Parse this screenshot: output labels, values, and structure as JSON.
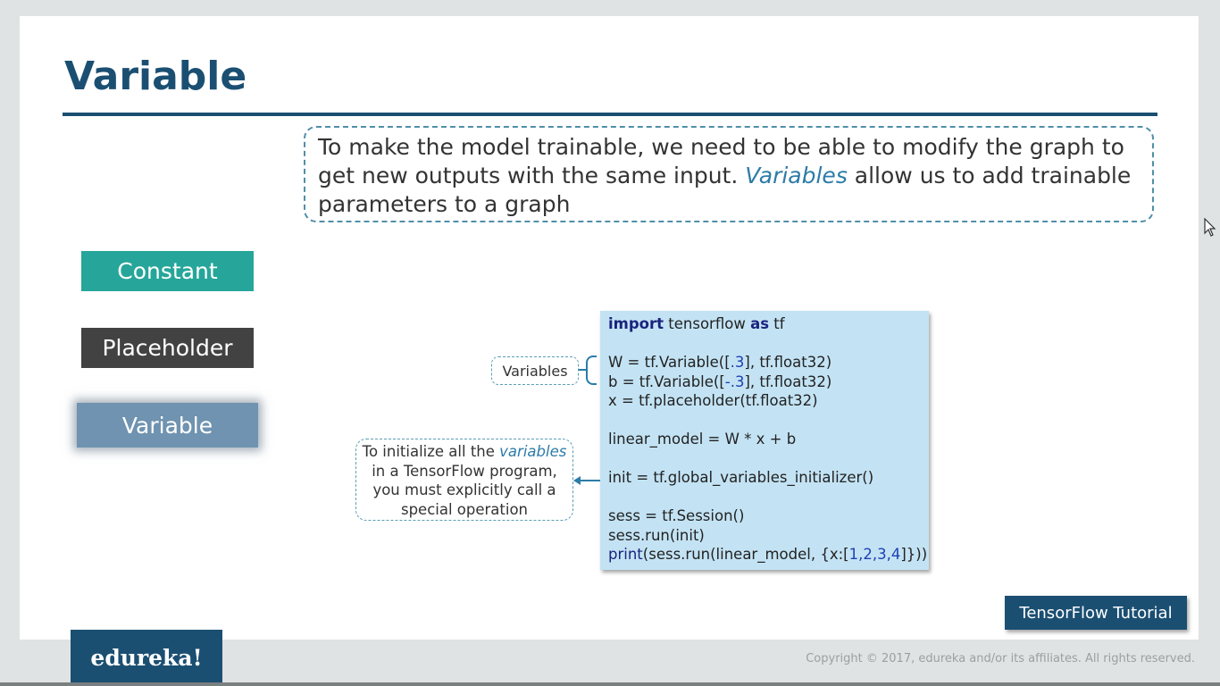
{
  "slide": {
    "title": "Variable",
    "intro_parts": {
      "before": "To make the model trainable, we need to be able to modify the graph to get new outputs with the same input. ",
      "highlight": "Variables",
      "after": " allow  us to add trainable parameters to a graph"
    },
    "side_buttons": {
      "constant": "Constant",
      "placeholder": "Placeholder",
      "variable": "Variable"
    },
    "code": {
      "import_kw": "import",
      "import_mid": " tensorflow ",
      "as_kw": "as",
      "import_end": " tf",
      "w_pre": "W = tf.Variable([",
      "w_num": ".3",
      "w_post": "], tf.float32)",
      "b_pre": "b = tf.Variable([",
      "b_num": "-.3",
      "b_post": "], tf.float32)",
      "x_line": "x = tf.placeholder(tf.float32)",
      "model_line": "linear_model = W * x + b",
      "init_line": "init = tf.global_variables_initializer()",
      "sess_line": "sess = tf.Session()",
      "run_line": "sess.run(init)",
      "print_kw": "print",
      "print_mid": "(sess.run(linear_model, {x:[",
      "print_nums": "1,2,3,4",
      "print_end": "]}))"
    },
    "variables_label": "Variables",
    "init_note": {
      "before": "To initialize all the ",
      "highlight": "variables",
      "after": " in a TensorFlow program, you must explicitly call a special operation"
    },
    "tag": "TensorFlow Tutorial",
    "logo": "edureka!",
    "copyright": "Copyright © 2017, edureka and/or its affiliates. All rights reserved."
  }
}
